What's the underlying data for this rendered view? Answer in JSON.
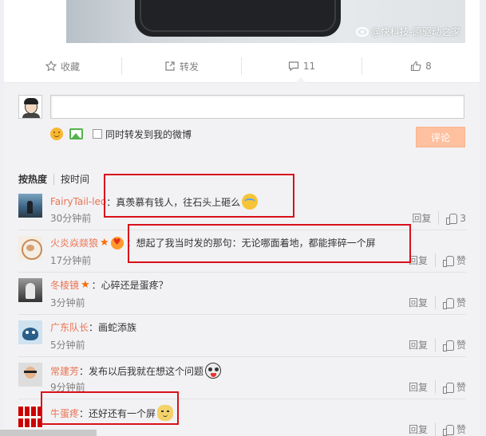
{
  "post": {
    "watermark": "@快科技-原驱动之家"
  },
  "actions": [
    {
      "icon": "star-icon",
      "label": "收藏"
    },
    {
      "icon": "share-icon",
      "label": "转发"
    },
    {
      "icon": "comment-icon",
      "label": "11"
    },
    {
      "icon": "like-icon",
      "label": "8"
    }
  ],
  "composer": {
    "input_value": "",
    "repost_label": "同时转发到我的微博",
    "submit_label": "评论"
  },
  "sort": {
    "by_hot": "按热度",
    "by_time": "按时间"
  },
  "comments": [
    {
      "name": "FairyTail-leo",
      "text": "：真羡慕有钱人，往石头上砸么",
      "time": "30分钟前",
      "reply": "回复",
      "like": "3"
    },
    {
      "name": "火炎焱燚狼",
      "text": "：想起了我当时发的那句：无论哪面着地，都能摔碎一个屏",
      "time": "17分钟前",
      "reply": "回复",
      "like": "赞"
    },
    {
      "name": "冬棱镜",
      "text": "：心碎还是蛋疼？",
      "time": "3分钟前",
      "reply": "回复",
      "like": "赞"
    },
    {
      "name": "广东队长",
      "text": "：画蛇添族",
      "time": "5分钟前",
      "reply": "回复",
      "like": "赞"
    },
    {
      "name": "常建芳",
      "text": "：发布以后我就在想这个问题",
      "time": "9分钟前",
      "reply": "回复",
      "like": "赞"
    },
    {
      "name": "牛蛋疼",
      "text": "：还好还有一个屏",
      "time": "",
      "reply": "回复",
      "like": "赞"
    }
  ],
  "colors": {
    "name": "#eb7350",
    "submit_bg": "#ffc09f",
    "highlight": "#d9101a"
  }
}
